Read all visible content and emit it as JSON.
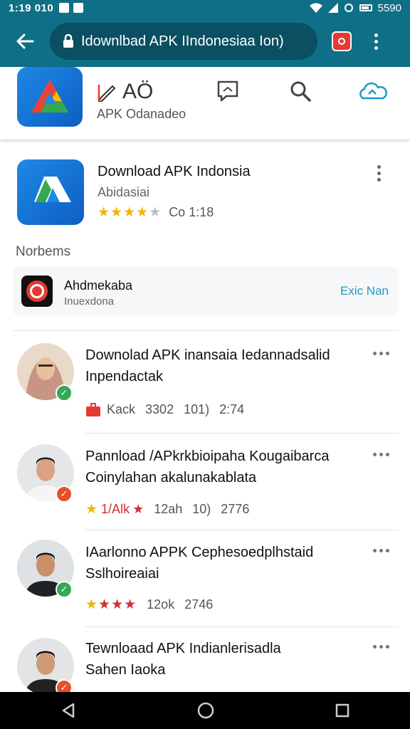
{
  "status_bar": {
    "time": "1:19 010",
    "battery": "5590"
  },
  "browser": {
    "url": "Idownlbad APK IIndonesiaa Ion)"
  },
  "toolbar": {
    "tool_label": "AÖ",
    "tool_sub": "APK Odanadeo",
    "icons": [
      "edit-icon",
      "chat-icon",
      "search-icon",
      "cloud-icon"
    ]
  },
  "featured": {
    "title": "Download APK Indonsia",
    "subtitle": "Abidasiai",
    "rating_stars": 4,
    "rating_text": "Co  1:18"
  },
  "section": {
    "label": "Norbems"
  },
  "notification": {
    "title": "Ahdmekaba",
    "subtitle": "Inuexdona",
    "action": "Exic Nan"
  },
  "items": [
    {
      "line1": "Downolad APK inansaia Iedannadsalid",
      "line2": "Inpendactak",
      "meta": [
        "Kack",
        "3302",
        "101)",
        "2:74"
      ],
      "badge_color": "#34a853"
    },
    {
      "line1": "Pannload /APkrkbioipaha Kougaibarca",
      "line2": "Coinylahan akalunakablata",
      "meta": [
        "1/Alk",
        "12ah",
        "10)",
        "2776"
      ],
      "badge_color": "#e8502a"
    },
    {
      "line1": "IAarlonno APPK Cephesoedplhstaid",
      "line2": "Sslhoireaiai",
      "meta": [
        "12ok",
        "2746"
      ],
      "badge_color": "#34a853"
    },
    {
      "line1": "Tewnloaad APK Indianlerisadla",
      "line2": "Sahen Iaoka",
      "meta": [],
      "badge_color": "#e8502a"
    }
  ]
}
